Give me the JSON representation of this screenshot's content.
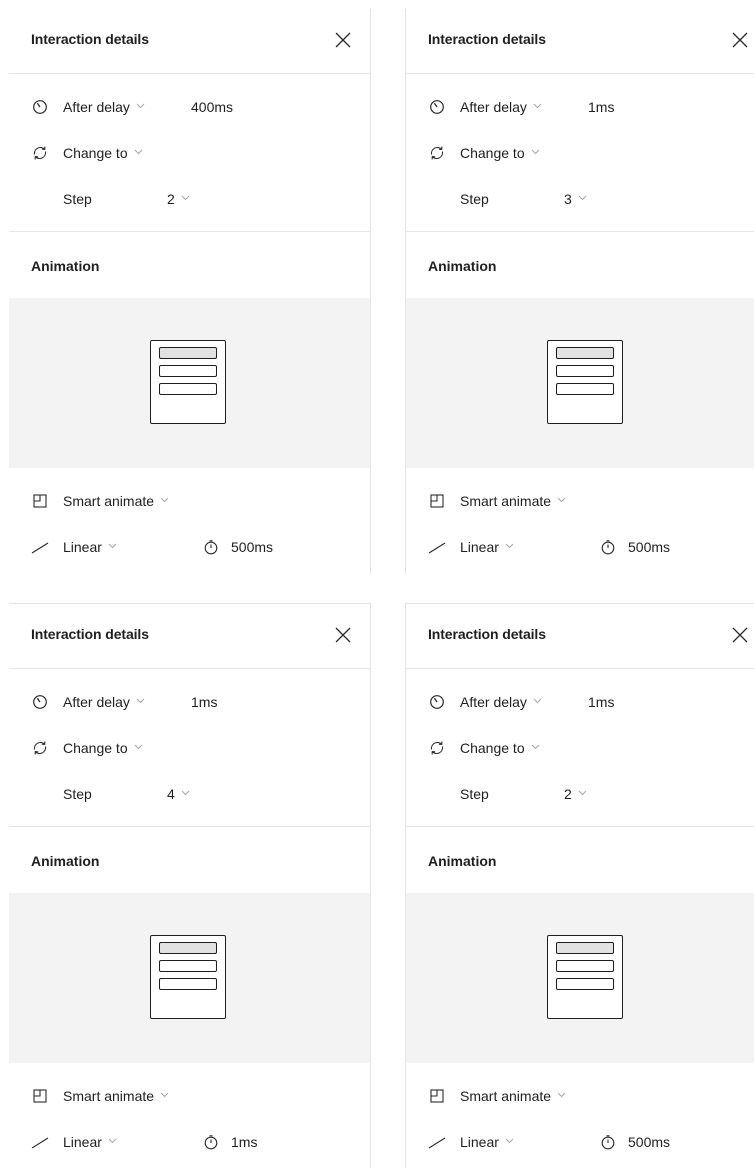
{
  "panels": [
    {
      "title": "Interaction details",
      "trigger_label": "After delay",
      "delay_value": "400ms",
      "action_label": "Change to",
      "step_label": "Step",
      "step_value": "2",
      "animation_title": "Animation",
      "animation_type": "Smart animate",
      "easing": "Linear",
      "duration": "500ms"
    },
    {
      "title": "Interaction details",
      "trigger_label": "After delay",
      "delay_value": "1ms",
      "action_label": "Change to",
      "step_label": "Step",
      "step_value": "3",
      "animation_title": "Animation",
      "animation_type": "Smart animate",
      "easing": "Linear",
      "duration": "500ms"
    },
    {
      "title": "Interaction details",
      "trigger_label": "After delay",
      "delay_value": "1ms",
      "action_label": "Change to",
      "step_label": "Step",
      "step_value": "4",
      "animation_title": "Animation",
      "animation_type": "Smart animate",
      "easing": "Linear",
      "duration": "1ms"
    },
    {
      "title": "Interaction details",
      "trigger_label": "After delay",
      "delay_value": "1ms",
      "action_label": "Change to",
      "step_label": "Step",
      "step_value": "2",
      "animation_title": "Animation",
      "animation_type": "Smart animate",
      "easing": "Linear",
      "duration": "500ms"
    }
  ],
  "icons": {
    "close": "close-icon",
    "trigger": "timer-icon",
    "action": "change-to-icon",
    "animation": "smart-animate-icon",
    "easing": "linear-curve-icon",
    "duration": "stopwatch-icon",
    "caret": "chevron-down-icon"
  },
  "colors": {
    "text": "#1f1f1f",
    "muted": "#a6a6a6",
    "divider": "#e6e6e6",
    "preview_bg": "#f3f3f3",
    "active_bar": "#e2e2e2"
  }
}
